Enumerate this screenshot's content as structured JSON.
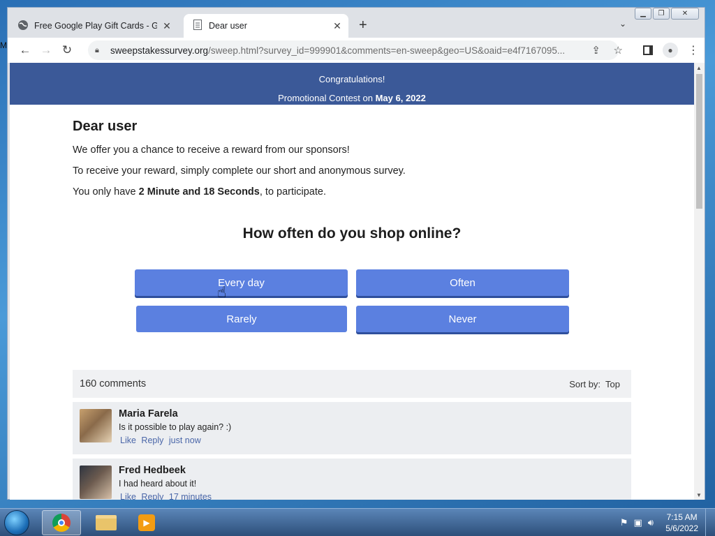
{
  "desktop": {
    "edge_text": "M"
  },
  "browser": {
    "tabs": [
      {
        "title": "Free Google Play Gift Cards - Gift",
        "icon": "globe-icon"
      },
      {
        "title": "Dear user",
        "icon": "page-icon"
      }
    ],
    "url": {
      "domain": "sweepstakessurvey.org",
      "path": "/sweep.html?survey_id=999901&comments=en-sweep&geo=US&oaid=e4f7167095..."
    }
  },
  "page": {
    "banner": {
      "line1": "Congratulations!",
      "line2_prefix": "Promotional Contest on ",
      "line2_date": "May 6, 2022"
    },
    "heading": "Dear user",
    "para1": "We offer you a chance to receive a reward from our sponsors!",
    "para2": "To receive your reward, simply complete our short and anonymous survey.",
    "para3_prefix": "You only have ",
    "para3_timer": "2 Minute and 18 Seconds",
    "para3_suffix": ", to participate.",
    "question": "How often do you shop online?",
    "answers": [
      "Every day",
      "Often",
      "Rarely",
      "Never"
    ],
    "comments": {
      "count_label": "160 comments",
      "sort_label": "Sort by:",
      "sort_value": "Top",
      "items": [
        {
          "name": "Maria Farela",
          "text": "Is it possible to play again? :)",
          "like": "Like",
          "reply": "Reply",
          "time": "just now"
        },
        {
          "name": "Fred Hedbeek",
          "text": "I had heard about it!",
          "like": "Like",
          "reply": "Reply",
          "time": "17 minutes"
        }
      ]
    }
  },
  "taskbar": {
    "time": "7:15 AM",
    "date": "5/6/2022"
  }
}
